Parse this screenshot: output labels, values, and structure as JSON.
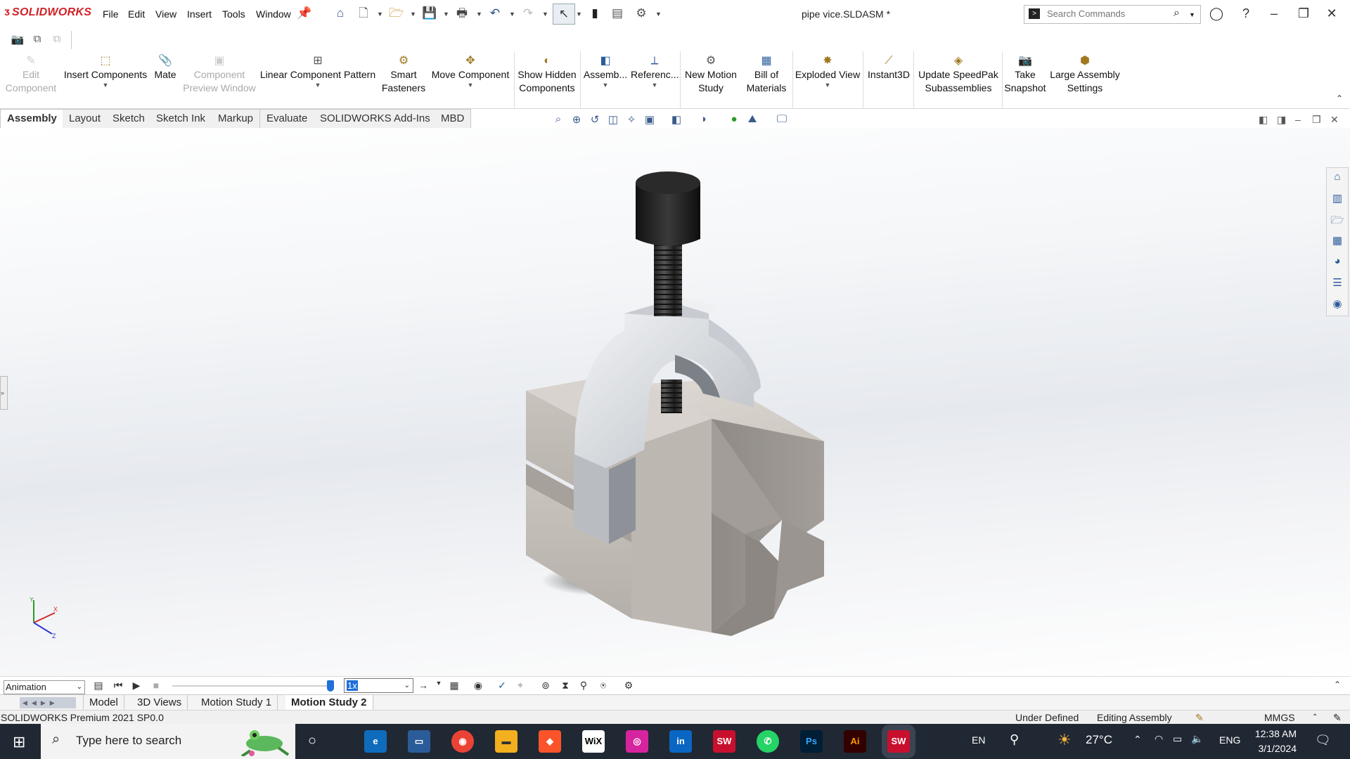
{
  "app": {
    "brand": "SOLIDWORKS",
    "document_title": "pipe vice.SLDASM *"
  },
  "menu": [
    "File",
    "Edit",
    "View",
    "Insert",
    "Tools",
    "Window"
  ],
  "search": {
    "placeholder": "Search Commands"
  },
  "commands": [
    {
      "id": "edit-component",
      "lines": [
        "Edit",
        "Component"
      ],
      "enabled": false,
      "dropdown": false
    },
    {
      "id": "insert-components",
      "lines": [
        "Insert Components",
        ""
      ],
      "enabled": true,
      "dropdown": true
    },
    {
      "id": "mate",
      "lines": [
        "Mate",
        ""
      ],
      "enabled": true,
      "dropdown": false
    },
    {
      "id": "component-preview-window",
      "lines": [
        "Component",
        "Preview Window"
      ],
      "enabled": false,
      "dropdown": false
    },
    {
      "id": "linear-component-pattern",
      "lines": [
        "Linear Component Pattern",
        ""
      ],
      "enabled": true,
      "dropdown": true
    },
    {
      "id": "smart-fasteners",
      "lines": [
        "Smart",
        "Fasteners"
      ],
      "enabled": true,
      "dropdown": false
    },
    {
      "id": "move-component",
      "lines": [
        "Move Component",
        ""
      ],
      "enabled": true,
      "dropdown": true
    },
    {
      "id": "show-hidden-components",
      "lines": [
        "Show Hidden",
        "Components"
      ],
      "enabled": true,
      "dropdown": false
    },
    {
      "id": "assembly-features",
      "lines": [
        "Assemb...",
        ""
      ],
      "enabled": true,
      "dropdown": true
    },
    {
      "id": "reference-geometry",
      "lines": [
        "Referenc...",
        ""
      ],
      "enabled": true,
      "dropdown": true
    },
    {
      "id": "new-motion-study",
      "lines": [
        "New Motion",
        "Study"
      ],
      "enabled": true,
      "dropdown": false
    },
    {
      "id": "bill-of-materials",
      "lines": [
        "Bill of",
        "Materials"
      ],
      "enabled": true,
      "dropdown": false
    },
    {
      "id": "exploded-view",
      "lines": [
        "Exploded View",
        ""
      ],
      "enabled": true,
      "dropdown": true
    },
    {
      "id": "instant3d",
      "lines": [
        "Instant3D",
        ""
      ],
      "enabled": true,
      "dropdown": false
    },
    {
      "id": "update-speedpak",
      "lines": [
        "Update SpeedPak",
        "Subassemblies"
      ],
      "enabled": true,
      "dropdown": false
    },
    {
      "id": "take-snapshot",
      "lines": [
        "Take",
        "Snapshot"
      ],
      "enabled": true,
      "dropdown": false
    },
    {
      "id": "large-assembly-settings",
      "lines": [
        "Large Assembly",
        "Settings"
      ],
      "enabled": true,
      "dropdown": false
    }
  ],
  "tabs": [
    "Assembly",
    "Layout",
    "Sketch",
    "Sketch Ink",
    "Markup",
    "Evaluate",
    "SOLIDWORKS Add-Ins",
    "MBD"
  ],
  "active_tab": "Assembly",
  "animation": {
    "mode": "Animation",
    "speed": "1x"
  },
  "bottom_tabs": [
    "Model",
    "3D Views",
    "Motion Study 1",
    "Motion Study 2"
  ],
  "active_bottom_tab": "Motion Study 2",
  "status": {
    "version": "SOLIDWORKS Premium 2021 SP0.0",
    "definition": "Under Defined",
    "mode": "Editing Assembly",
    "units": "MMGS"
  },
  "taskbar": {
    "search_placeholder": "Type here to search",
    "apps": [
      "edge-icon",
      "file-explorer-icon",
      "chrome-icon",
      "folder-icon",
      "brave-icon",
      "wix-icon",
      "instagram-icon",
      "linkedin-icon",
      "solidworks-icon",
      "whatsapp-icon",
      "photoshop-icon",
      "illustrator-icon",
      "solidworks-2021-icon"
    ],
    "language_short": "EN",
    "temperature": "27°C",
    "language": "ENG",
    "time": "12:38 AM",
    "date": "3/1/2024"
  },
  "colors": {
    "brand_red": "#d22027",
    "accent_blue": "#1e6fd9",
    "taskbar": "#202833"
  }
}
